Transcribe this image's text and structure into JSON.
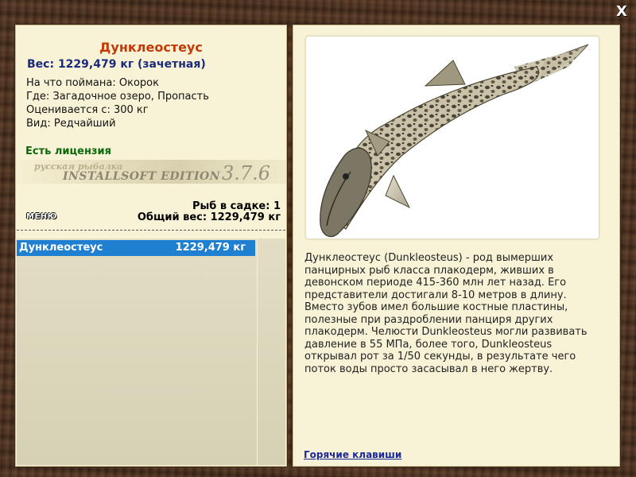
{
  "window": {
    "close_label": "X"
  },
  "fish": {
    "name": "Дунклеостеус",
    "weight_line": "Вес: 1229,479 кг (зачетная)",
    "caught_on": "На что поймана: Окорок",
    "location": "Где: Загадочное озеро, Пропасть",
    "valued_from": "Оценивается с: 300 кг",
    "rarity": "Вид: Редчайший"
  },
  "license": "Есть лицензия",
  "edition": {
    "rus": "русская рыбалка",
    "name": "INSTALLSOFT EDITION",
    "version": "3.7.6"
  },
  "menu_label": "МЕНЮ",
  "keepnet": {
    "count": "Рыб в садке: 1",
    "total": "Общий вес: 1229,479 кг"
  },
  "list": [
    {
      "name": "Дунклеостеус",
      "weight": "1229,479 кг"
    }
  ],
  "description": "Дунклеостеус (Dunkleosteus) - род вымерших панцирных рыб класса плакодерм, живших в девонском периоде 415-360 млн лет назад. Его представители достигали 8-10 метров в длину. Вместо зубов имел большие костные пластины, полезные при раздроблении панциря других плакодерм. Челюсти Dunkleosteus могли развивать давление в 55 МПа, более того, Dunkleosteus открывал рот за 1/50 секунды, в результате чего поток воды просто засасывал в него жертву.",
  "hotkeys_label": "Горячие клавиши"
}
